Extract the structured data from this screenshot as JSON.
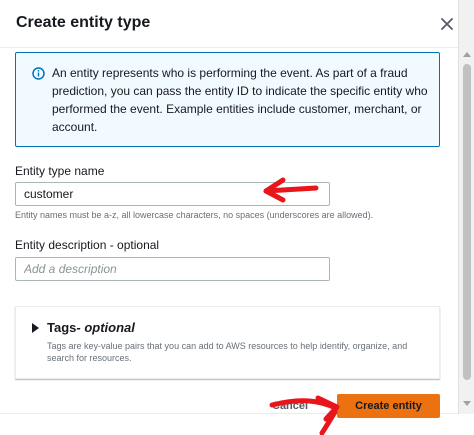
{
  "modal": {
    "title": "Create entity type",
    "close_icon": "close-icon"
  },
  "info": {
    "icon": "info-icon",
    "text": "An entity represents who is performing the event. As part of a fraud prediction, you can pass the entity ID to indicate the specific entity who performed the event. Example entities include customer, merchant, or account."
  },
  "entity_type_name": {
    "label": "Entity type name",
    "value": "customer",
    "constraint": "Entity names must be a-z, all lowercase characters, no spaces (underscores are allowed)."
  },
  "entity_description": {
    "label": "Entity description - optional",
    "placeholder": "Add a description",
    "value": ""
  },
  "tags": {
    "title": "Tags",
    "optional": " - optional",
    "description": "Tags are key-value pairs that you can add to AWS resources to help identify, organize, and search for resources."
  },
  "footer": {
    "cancel_label": "Cancel",
    "create_label": "Create entity"
  },
  "colors": {
    "primary_button": "#ec7211",
    "info_border": "#0073bb",
    "info_background": "#f1faff",
    "annotation_arrow": "#e8151b"
  }
}
